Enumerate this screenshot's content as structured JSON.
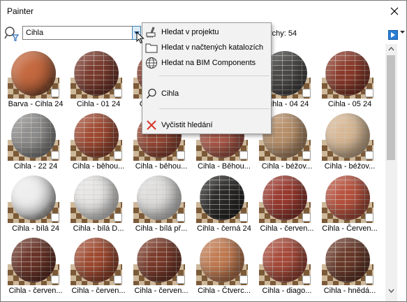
{
  "window": {
    "title": "Painter"
  },
  "search": {
    "value": "Cihla",
    "count_label": "rchy: 54"
  },
  "dropdown": {
    "items": [
      {
        "label": "Hledat v projektu",
        "icon": "brush-icon"
      },
      {
        "label": "Hledat v načtených katalozích",
        "icon": "folder-icon"
      },
      {
        "label": "Hledat na BIM Components",
        "icon": "globe-icon"
      },
      {
        "label": "Cihla",
        "icon": "search-icon"
      },
      {
        "label": "Vyčistit hledání",
        "icon": "clear-icon"
      }
    ]
  },
  "materials": [
    {
      "label": "Barva - Cihla 24",
      "color": "#c4693f",
      "style": "plain"
    },
    {
      "label": "Cihla - 01 24",
      "color": "#7a3a2e",
      "style": "brick"
    },
    {
      "label": "Cihla - 02 24",
      "color": "#8a4030",
      "style": "brick"
    },
    {
      "label": "Cihla - 03 24",
      "color": "#6b3328",
      "style": "brick"
    },
    {
      "label": "Cihla - 04 24",
      "color": "#4a4a4a",
      "style": "brick"
    },
    {
      "label": "Cihla - 05 24",
      "color": "#8b3a2a",
      "style": "brick"
    },
    {
      "label": "Cihla - 22 24",
      "color": "#8d8d8d",
      "style": "brick"
    },
    {
      "label": "Cihla - běhou...",
      "color": "#a04a32",
      "style": "brick"
    },
    {
      "label": "Cihla - běhou...",
      "color": "#9a4a36",
      "style": "brick"
    },
    {
      "label": "Cihla - Běhou...",
      "color": "#b05a4a",
      "style": "brick"
    },
    {
      "label": "Cihla - béžov...",
      "color": "#b8906a",
      "style": "brick"
    },
    {
      "label": "Cihla - béžov...",
      "color": "#d8b894",
      "style": "brick"
    },
    {
      "label": "Cihla - bílá 24",
      "color": "#eeeeee",
      "style": "plain"
    },
    {
      "label": "Cihla - bílá D...",
      "color": "#e6e6e6",
      "style": "brick"
    },
    {
      "label": "Cihla - bílá př...",
      "color": "#dedede",
      "style": "brick"
    },
    {
      "label": "Cihla - černá 24",
      "color": "#2a2a2a",
      "style": "brick"
    },
    {
      "label": "Cihla - červen...",
      "color": "#9a3a30",
      "style": "brick"
    },
    {
      "label": "Cihla - Červen...",
      "color": "#b8523e",
      "style": "brick"
    },
    {
      "label": "Cihla - červen...",
      "color": "#6a3428",
      "style": "brick"
    },
    {
      "label": "Cihla - červen...",
      "color": "#a04a30",
      "style": "brick"
    },
    {
      "label": "Cihla - červen...",
      "color": "#7a3a2a",
      "style": "brick"
    },
    {
      "label": "Cihla - Čtverc...",
      "color": "#c27a50",
      "style": "brick"
    },
    {
      "label": "Cihla - diago...",
      "color": "#a84a3a",
      "style": "brick"
    },
    {
      "label": "Cihla - hnědá...",
      "color": "#6a3a2a",
      "style": "brick"
    }
  ]
}
